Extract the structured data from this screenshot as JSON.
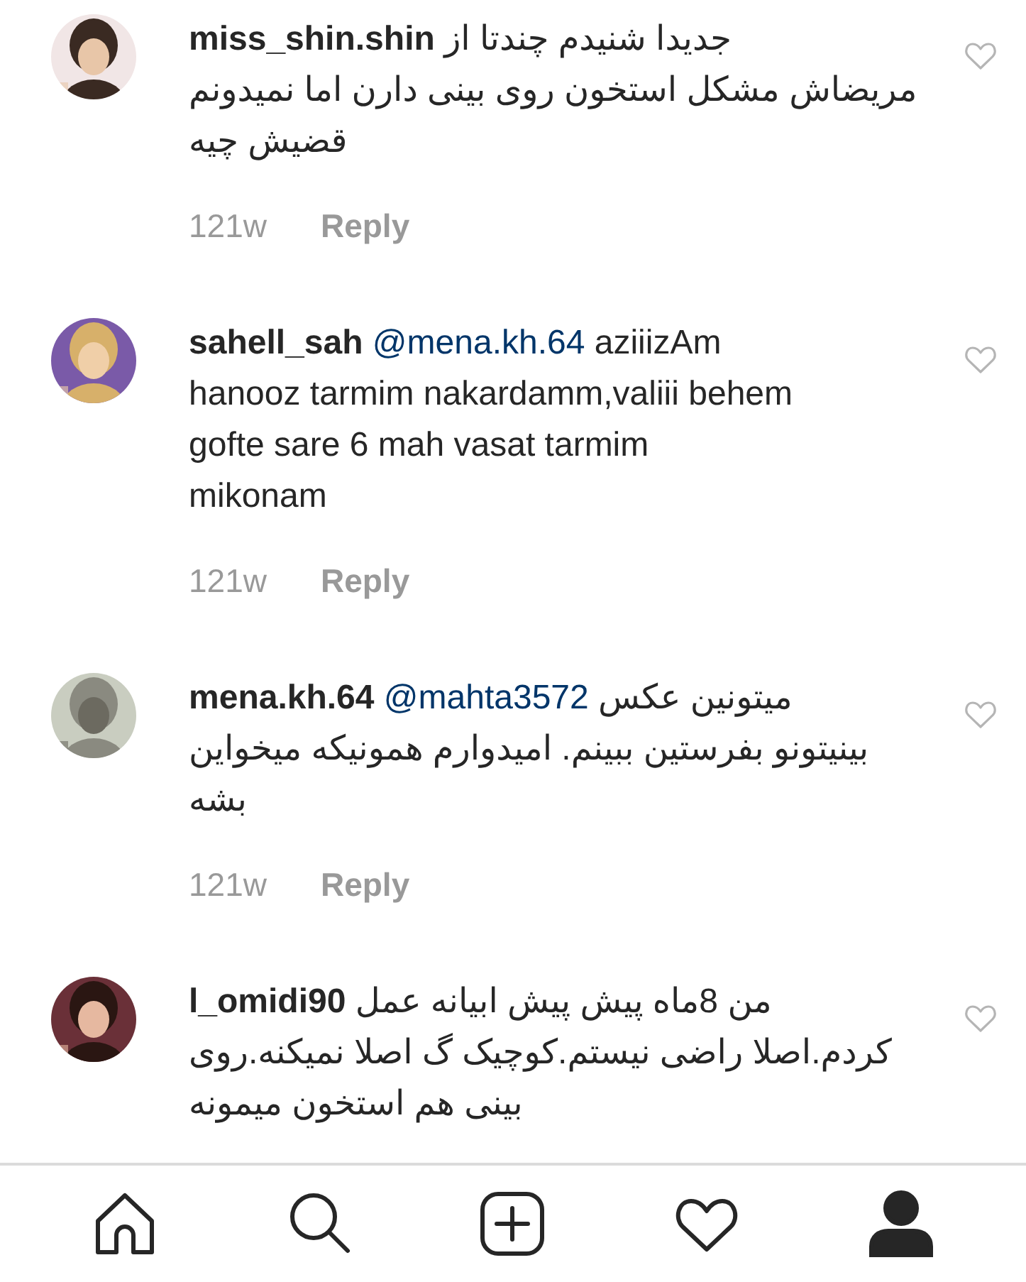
{
  "comments": [
    {
      "username": "miss_shin.shin",
      "lines": [
        "جدیدا شنیدم چندتا از",
        "مریضاش مشکل استخون روی بینی دارن اما نمیدونم",
        "قضیش چیه"
      ],
      "time": "121w",
      "reply": "Reply",
      "liked": false,
      "avatar": {
        "kind": "picture"
      }
    },
    {
      "username": "sahell_sah",
      "mention": "@mena.kh.64",
      "lines": [
        "aziiizAm",
        "hanooz tarmim nakardamm,valiii behem",
        "gofte sare 6 mah vasat tarmim",
        "mikonam"
      ],
      "time": "121w",
      "reply": "Reply",
      "liked": false,
      "avatar": {
        "kind": "picture"
      }
    },
    {
      "username": "mena.kh.64",
      "mention": "@mahta3572",
      "lines": [
        "میتونین عکس",
        "بینیتونو بفرستین ببینم. امیدوارم همونیکه میخواین",
        "بشه"
      ],
      "time": "121w",
      "reply": "Reply",
      "liked": false,
      "avatar": {
        "kind": "picture"
      }
    },
    {
      "username": "l_omidi90",
      "lines": [
        "من 8ماه پیش پیش ابیانه عمل",
        "کردم.اصلا راضی نیستم.کوچیک گ اصلا نمیکنه.روی",
        "بینی هم استخون میمونه"
      ],
      "liked": false,
      "avatar": {
        "kind": "picture"
      }
    }
  ],
  "tabbar": [
    {
      "kind": "home",
      "selected": false
    },
    {
      "kind": "search",
      "selected": false
    },
    {
      "kind": "add",
      "selected": false
    },
    {
      "kind": "activity",
      "selected": false
    },
    {
      "kind": "profile",
      "selected": true
    }
  ]
}
